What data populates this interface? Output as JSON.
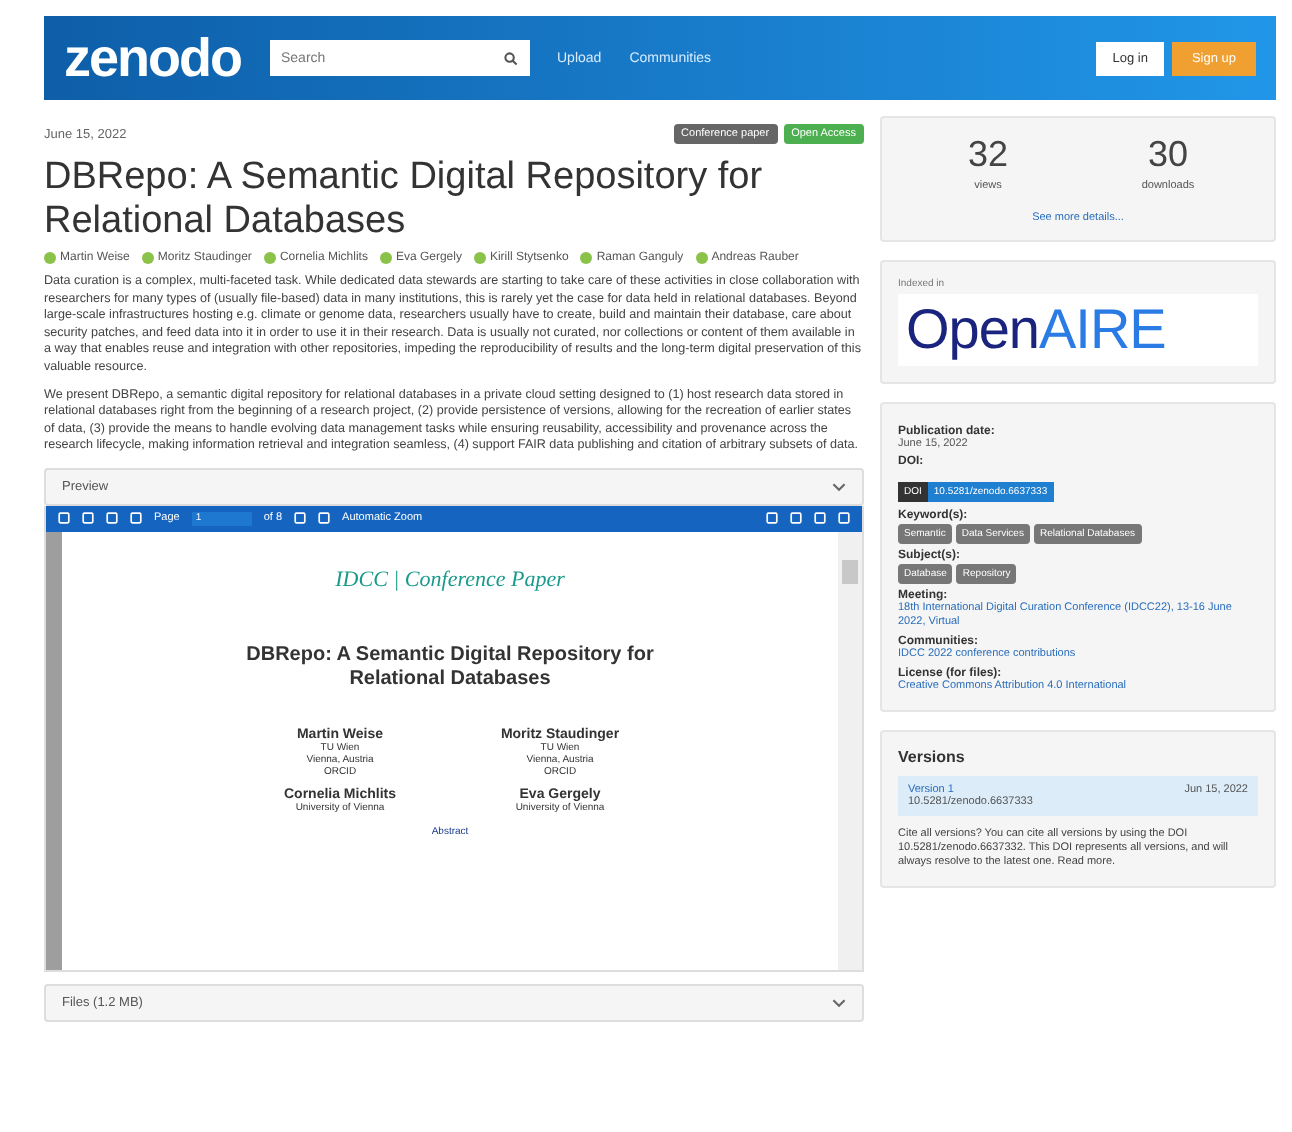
{
  "header": {
    "logo": "zenodo",
    "search": {
      "placeholder": "Search"
    },
    "links": [
      "Upload",
      "Communities"
    ],
    "login": "Log in",
    "signup": "Sign up"
  },
  "record": {
    "date": "June 15, 2022",
    "badges": [
      {
        "label": "Conference paper",
        "kind": "type"
      },
      {
        "label": "Open Access",
        "kind": "access"
      }
    ],
    "title": "DBRepo: A Semantic Digital Repository for Relational Databases",
    "authors": [
      "Martin Weise",
      "Moritz Staudinger",
      "Cornelia Michlits",
      "Eva Gergely",
      "Kirill Stytsenko",
      "Raman Ganguly",
      "Andreas Rauber"
    ],
    "abstract": [
      "Data curation is a complex, multi-faceted task. While dedicated data stewards are starting to take care of these activities in close collaboration with researchers for many types of (usually file-based) data in many institutions, this is rarely yet the case for data held in relational databases. Beyond large-scale infrastructures hosting e.g. climate or genome data, researchers usually have to create, build and maintain their database, care about security patches, and feed data into it in order to use it in their research. Data is usually not curated, nor collections or content of them available in a way that enables reuse and integration with other repositories, impeding the reproducibility of results and the long-term digital preservation of this valuable resource.",
      "We present DBRepo, a semantic digital repository for relational databases in a private cloud setting designed to (1) host research data stored in relational databases right from the beginning of a research project, (2) provide persistence of versions, allowing for the recreation of earlier states of data, (3) provide the means to handle evolving data management tasks while ensuring reusability, accessibility and provenance across the research lifecycle, making information retrieval and integration seamless, (4) support FAIR data publishing and citation of arbitrary subsets of data."
    ],
    "preview": {
      "heading": "Preview",
      "toolbar": {
        "page_label": "Page",
        "page_value": "1",
        "page_count": "of 8",
        "zoom": "Automatic Zoom"
      },
      "document": {
        "banner": "IDCC | Conference Paper",
        "title": "DBRepo: A Semantic Digital Repository for Relational Databases",
        "authors": [
          {
            "name": "Martin Weise",
            "org": "TU Wien",
            "place": "Vienna, Austria",
            "mail": "ORCID"
          },
          {
            "name": "Moritz Staudinger",
            "org": "TU Wien",
            "place": "Vienna, Austria",
            "mail": "ORCID"
          },
          {
            "name": "Cornelia Michlits",
            "org": "University of Vienna"
          },
          {
            "name": "Eva Gergely",
            "org": "University of Vienna"
          }
        ],
        "footer": "Abstract"
      }
    },
    "files_heading": "Files (1.2 MB)"
  },
  "stats": {
    "views": "32",
    "views_label": "views",
    "downloads": "30",
    "downloads_label": "downloads",
    "more": "See more details..."
  },
  "indexed": {
    "label": "Indexed in",
    "logo_a": "Open",
    "logo_b": "AIRE"
  },
  "meta": [
    {
      "heading": "Publication date:",
      "kind": "text",
      "value": "June 15, 2022"
    },
    {
      "heading": "DOI:",
      "kind": "doi",
      "prefix": "DOI",
      "value": "10.5281/zenodo.6637333"
    },
    {
      "heading": "Keyword(s):",
      "kind": "tags",
      "tags": [
        "Semantic",
        "Data Services",
        "Relational Databases"
      ]
    },
    {
      "heading": "Subject(s):",
      "kind": "tags",
      "tags": [
        "Database",
        "Repository"
      ]
    },
    {
      "heading": "Meeting:",
      "kind": "link",
      "value": "18th International Digital Curation Conference (IDCC22), 13-16 June 2022, Virtual"
    },
    {
      "heading": "Communities:",
      "kind": "link",
      "value": "IDCC 2022 conference contributions"
    },
    {
      "heading": "License (for files):",
      "kind": "link",
      "value": "Creative Commons Attribution 4.0 International"
    }
  ],
  "versions": {
    "heading": "Versions",
    "items": [
      {
        "name": "Version 1",
        "date": "Jun 15, 2022",
        "doi": "10.5281/zenodo.6637333",
        "selected": true
      }
    ],
    "note": "Cite all versions? You can cite all versions by using the DOI 10.5281/zenodo.6637332. This DOI represents all versions, and will always resolve to the latest one. Read more."
  }
}
